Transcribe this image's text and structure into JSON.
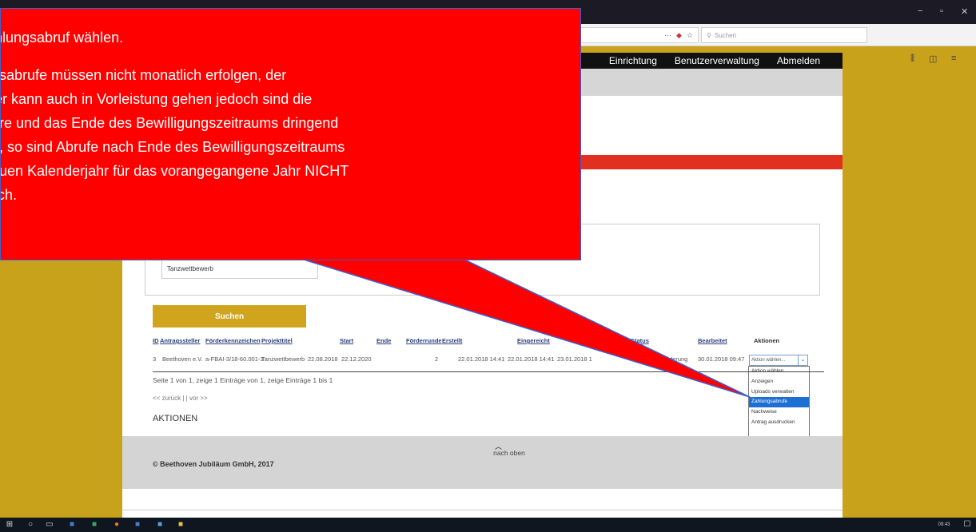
{
  "browser": {
    "search_placeholder": "Suchen",
    "url_dots": "···"
  },
  "nav": {
    "items": [
      "Einrichtung",
      "Benutzerverwaltung",
      "Abmelden"
    ]
  },
  "filter": {
    "projekttitel_value": "Tanzwettbewerb",
    "search_button": "Suchen"
  },
  "table": {
    "headers": [
      "ID",
      "Antragssteller",
      "Förderkennzeichen",
      "Projekttitel",
      "Start",
      "Ende",
      "Förderrunde",
      "Erstellt",
      "Eingereicht",
      "Status",
      "Bearbeitet",
      "Aktionen"
    ],
    "row": {
      "id": "3",
      "antragssteller": "Beethoven e.V.",
      "foerderkennzeichen": "a-FBAI-3/18-60.001-3",
      "projekttitel": "Tanzwettbewerb",
      "start": "22.08.2018",
      "ende": "22.12.2020",
      "foerderrunde": "2",
      "erstellt": "22.01.2018 14:41",
      "eingereicht": "22.01.2018 14:41",
      "extra": "23.01.2018 1",
      "status": "derung",
      "bearbeitet": "30.01.2018 09:47"
    },
    "action_select": "Aktion wählen...",
    "action_options": [
      "Aktion wählen...",
      "Anzeigen",
      "Uploads verwalten",
      "Zahlungsabrufe",
      "Nachweise",
      "Antrag ausdrucken"
    ],
    "selected_option": "Zahlungsabrufe"
  },
  "pagination": {
    "summary": "Seite 1 von 1, zeige 1 Einträge von 1, zeige Einträge 1 bis 1",
    "prev_next": "<< zurück  |  |  vor >>"
  },
  "section_title": "AKTIONEN",
  "footer": {
    "back_to_top": "nach oben",
    "copyright": "© Beethoven Jubiläum GmbH, 2017"
  },
  "callout": {
    "title": "hlungsabruf wählen.",
    "body": "gsabrufe müssen nicht monatlich erfolgen, der\nler kann auch in Vorleistung gehen jedoch sind die\nhre und das Ende des Bewilligungszeitraums dringend\nn, so sind Abrufe nach Ende des Bewilligungszeitraums\neuen Kalenderjahr für das vorangegangene Jahr NICHT\nlich."
  },
  "taskbar": {
    "time": "09:43"
  },
  "colors": {
    "accent_gold": "#c9a21c",
    "callout_red": "#ff0000",
    "nav_black": "#111111",
    "red_bar": "#e1301f",
    "selected_blue": "#1e6fd2"
  }
}
